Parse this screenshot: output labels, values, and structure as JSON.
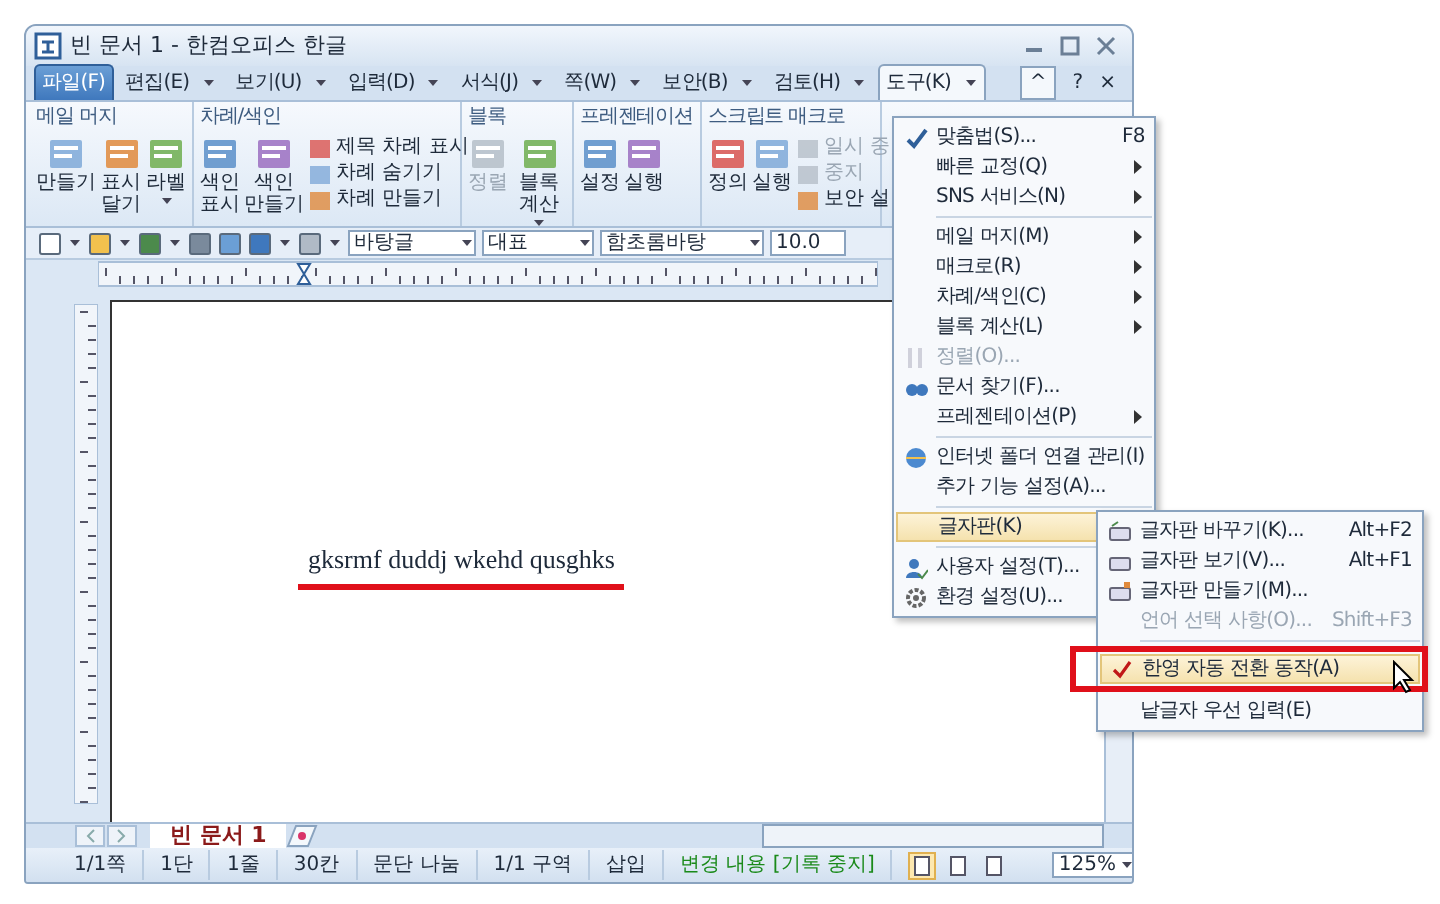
{
  "window": {
    "title": "빈 문서 1 - 한컴오피스 한글"
  },
  "menu_tabs": [
    {
      "label": "파일(F)",
      "selected": true,
      "open": false,
      "dropdown": false
    },
    {
      "label": "편집(E)",
      "selected": false,
      "open": false,
      "dropdown": true
    },
    {
      "label": "보기(U)",
      "selected": false,
      "open": false,
      "dropdown": true
    },
    {
      "label": "입력(D)",
      "selected": false,
      "open": false,
      "dropdown": true
    },
    {
      "label": "서식(J)",
      "selected": false,
      "open": false,
      "dropdown": true
    },
    {
      "label": "쪽(W)",
      "selected": false,
      "open": false,
      "dropdown": true
    },
    {
      "label": "보안(B)",
      "selected": false,
      "open": false,
      "dropdown": true
    },
    {
      "label": "검토(H)",
      "selected": false,
      "open": false,
      "dropdown": true
    },
    {
      "label": "도구(K)",
      "selected": false,
      "open": true,
      "dropdown": true
    }
  ],
  "ribbon_controls": [
    "^",
    "?",
    "×"
  ],
  "ribbon_groups": [
    {
      "title": "메일 머지",
      "items": [
        {
          "kind": "large",
          "label": "만들기",
          "disabled": false,
          "dropdown": false
        },
        {
          "kind": "large",
          "label": "표시 달기",
          "disabled": false,
          "dropdown": false
        },
        {
          "kind": "large",
          "label": "라벨",
          "disabled": false,
          "dropdown": true
        }
      ]
    },
    {
      "title": "차례/색인",
      "items": [
        {
          "kind": "large",
          "label": "색인 표시",
          "disabled": false,
          "dropdown": false
        },
        {
          "kind": "large",
          "label": "색인 만들기",
          "disabled": false,
          "dropdown": false
        },
        {
          "kind": "small",
          "label": "제목 차례 표시",
          "disabled": false
        },
        {
          "kind": "small",
          "label": "차례 숨기기",
          "disabled": false
        },
        {
          "kind": "small",
          "label": "차례 만들기",
          "disabled": false
        }
      ]
    },
    {
      "title": "블록",
      "items": [
        {
          "kind": "large",
          "label": "정렬",
          "disabled": true,
          "dropdown": false
        },
        {
          "kind": "large",
          "label": "블록 계산",
          "disabled": false,
          "dropdown": true
        }
      ]
    },
    {
      "title": "프레젠테이션",
      "items": [
        {
          "kind": "large",
          "label": "설정",
          "disabled": false,
          "dropdown": false
        },
        {
          "kind": "large",
          "label": "실행",
          "disabled": false,
          "dropdown": false
        }
      ]
    },
    {
      "title": "스크립트 매크로",
      "items": [
        {
          "kind": "large",
          "label": "정의",
          "disabled": false,
          "dropdown": false
        },
        {
          "kind": "large",
          "label": "실행",
          "disabled": false,
          "dropdown": false
        },
        {
          "kind": "small",
          "label": "일시 중",
          "disabled": true
        },
        {
          "kind": "small",
          "label": "중지",
          "disabled": true
        },
        {
          "kind": "small",
          "label": "보안 설",
          "disabled": false
        }
      ]
    }
  ],
  "toolbar_fields": [
    {
      "value": "바탕글"
    },
    {
      "value": "대표"
    },
    {
      "value": "함초롬바탕"
    },
    {
      "value": "10.0"
    }
  ],
  "document": {
    "text": "gksrmf duddj wkehd qusghks"
  },
  "doc_tabs": [
    {
      "label": "빈 문서 1",
      "selected": true
    }
  ],
  "status_bar": [
    {
      "label": "1/1쪽",
      "kind": "text"
    },
    {
      "label": "1단",
      "kind": "text"
    },
    {
      "label": "1줄",
      "kind": "text"
    },
    {
      "label": "30칸",
      "kind": "text"
    },
    {
      "label": "문단 나눔",
      "kind": "text"
    },
    {
      "label": "1/1 구역",
      "kind": "text"
    },
    {
      "label": "삽입",
      "kind": "text"
    },
    {
      "label": "변경 내용 [기록 중지]",
      "kind": "tracking"
    }
  ],
  "view_buttons": [
    {
      "selected": true
    },
    {
      "selected": false
    },
    {
      "selected": false
    }
  ],
  "zoom": {
    "value": "125%"
  },
  "tools_menu": [
    {
      "kind": "icon-item",
      "label": "맞춤법(S)...",
      "shortcut": "F8",
      "submenu": false,
      "disabled": false,
      "selected": false
    },
    {
      "kind": "item",
      "label": "빠른 교정(Q)",
      "submenu": true,
      "disabled": false,
      "selected": false
    },
    {
      "kind": "item",
      "label": "SNS 서비스(N)",
      "submenu": true,
      "disabled": false,
      "selected": false
    },
    {
      "kind": "separator"
    },
    {
      "kind": "item",
      "label": "메일 머지(M)",
      "submenu": true,
      "disabled": false,
      "selected": false
    },
    {
      "kind": "item",
      "label": "매크로(R)",
      "submenu": true,
      "disabled": false,
      "selected": false
    },
    {
      "kind": "item",
      "label": "차례/색인(C)",
      "submenu": true,
      "disabled": false,
      "selected": false
    },
    {
      "kind": "item",
      "label": "블록 계산(L)",
      "submenu": true,
      "disabled": false,
      "selected": false
    },
    {
      "kind": "icon-item",
      "label": "정렬(O)...",
      "submenu": false,
      "disabled": true,
      "selected": false
    },
    {
      "kind": "icon-item",
      "label": "문서 찾기(F)...",
      "submenu": false,
      "disabled": false,
      "selected": false
    },
    {
      "kind": "item",
      "label": "프레젠테이션(P)",
      "submenu": true,
      "disabled": false,
      "selected": false
    },
    {
      "kind": "separator"
    },
    {
      "kind": "icon-item",
      "label": "인터넷 폴더 연결 관리(I)",
      "submenu": false,
      "disabled": false,
      "selected": false
    },
    {
      "kind": "item",
      "label": "추가 기능 설정(A)...",
      "submenu": false,
      "disabled": false,
      "selected": false
    },
    {
      "kind": "separator"
    },
    {
      "kind": "item",
      "label": "글자판(K)",
      "submenu": true,
      "disabled": false,
      "selected": true
    },
    {
      "kind": "separator"
    },
    {
      "kind": "icon-item",
      "label": "사용자 설정(T)...",
      "submenu": false,
      "disabled": false,
      "selected": false
    },
    {
      "kind": "icon-item",
      "label": "환경 설정(U)...",
      "submenu": false,
      "disabled": false,
      "selected": false
    }
  ],
  "keyboard_submenu": [
    {
      "kind": "icon-item",
      "label": "글자판 바꾸기(K)...",
      "shortcut": "Alt+F2",
      "disabled": false,
      "checked": false,
      "selected": false
    },
    {
      "kind": "icon-item",
      "label": "글자판 보기(V)...",
      "shortcut": "Alt+F1",
      "disabled": false,
      "checked": false,
      "selected": false
    },
    {
      "kind": "icon-item",
      "label": "글자판 만들기(M)...",
      "disabled": false,
      "checked": false,
      "selected": false
    },
    {
      "kind": "item",
      "label": "언어 선택 사항(O)...",
      "shortcut": "Shift+F3",
      "disabled": true,
      "checked": false,
      "selected": false
    },
    {
      "kind": "separator"
    },
    {
      "kind": "item",
      "label": "한영 자동 전환 동작(A)",
      "disabled": false,
      "checked": true,
      "selected": true
    },
    {
      "kind": "item",
      "label": "낱글자 우선 입력(E)",
      "disabled": false,
      "checked": false,
      "selected": false
    }
  ]
}
